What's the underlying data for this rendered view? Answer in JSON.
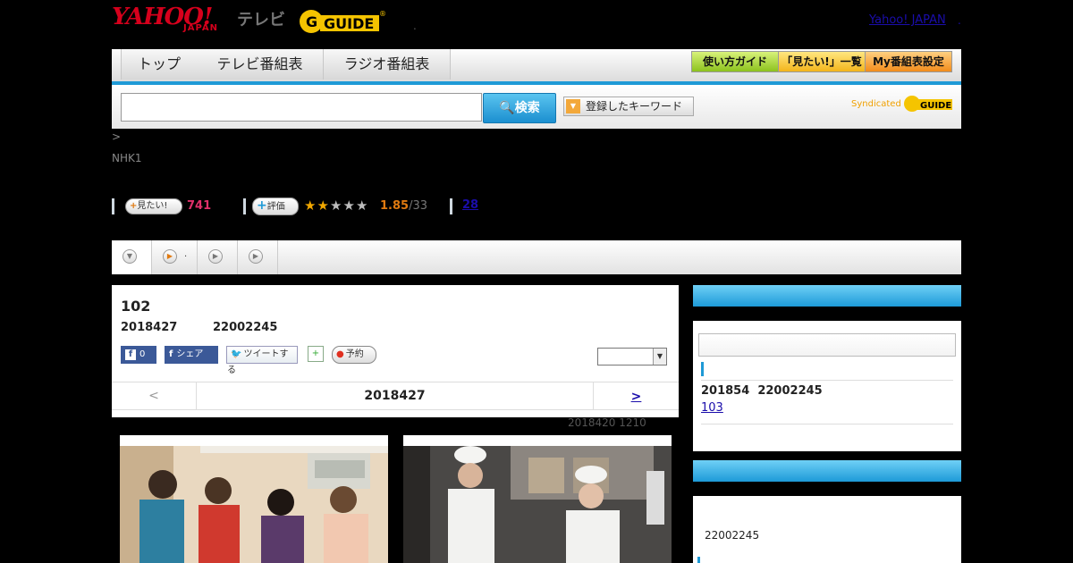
{
  "header": {
    "yahoo_logo": "YAHOO!",
    "japan_logo": "JAPAN",
    "tv_label": "テレビ",
    "gguide_logo": "G-GUIDE",
    "top_link": "Yahoo! JAPAN",
    "dot": "."
  },
  "nav": {
    "tabs": [
      "トップ",
      "テレビ番組表",
      "ラジオ番組表"
    ],
    "buttons": [
      "使い方ガイド",
      "「見たい!」一覧",
      "My番組表設定"
    ]
  },
  "search": {
    "input_value": "",
    "select_value": "",
    "button_label": "検索",
    "keyword_button": "登録したキーワード",
    "syndicated": "Syndicated"
  },
  "breadcrumb": ">",
  "channel": "NHK1",
  "stats": {
    "mitai_label": "見たい!",
    "mitai_count": "741",
    "hyouka_label": "評価",
    "rating": "1.85",
    "rating_suffix": "/33",
    "rating_value": 1.85,
    "reviews_link": "28"
  },
  "tabs": [
    {
      "icon": "chevron-down-icon",
      "label": ""
    },
    {
      "icon": "play-icon",
      "label": "."
    },
    {
      "icon": "play-icon",
      "label": ""
    },
    {
      "icon": "play-icon",
      "label": ""
    }
  ],
  "program": {
    "title": "102",
    "date": "2018427",
    "time": "22002245",
    "like_count": "0",
    "share_label": "シェア",
    "tweet_label": "ツイートする",
    "reserve_label": "予約",
    "select_value": "",
    "prev": "<",
    "current_date": "2018427",
    "next": ">",
    "previous_info": "2018420  1210"
  },
  "sidebar": {
    "box1": {
      "input_value": "",
      "date": "201854",
      "time": "22002245",
      "link": "103"
    },
    "box2": {
      "time": "22002245"
    }
  },
  "colors": {
    "accent": "#1e9ad6",
    "yahoo_red": "#d6001c",
    "gguide_yellow": "#f5c400",
    "count_pink": "#e0306a",
    "rating_orange": "#e07a10",
    "link_blue": "#1a0dab"
  }
}
